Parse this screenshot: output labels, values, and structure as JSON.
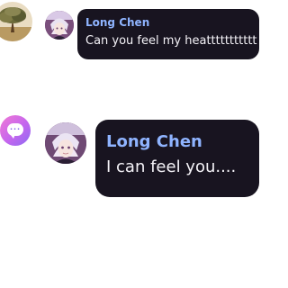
{
  "messages": [
    {
      "sender": "Long Chen",
      "text": "Can you feel my heattttttttttt",
      "left_avatar": "tree-photo-avatar"
    },
    {
      "sender": "Long Chen",
      "text": "I can feel you....",
      "left_avatar": "chat-bubble-app-icon",
      "app_icon_dots": "···"
    }
  ],
  "colors": {
    "bubble_background": "#181420",
    "sender_name": "#8fb4ff",
    "message_text": "#f5f3f8",
    "app_icon_gradient_start": "#f27ad4",
    "app_icon_gradient_end": "#8d6af2"
  }
}
